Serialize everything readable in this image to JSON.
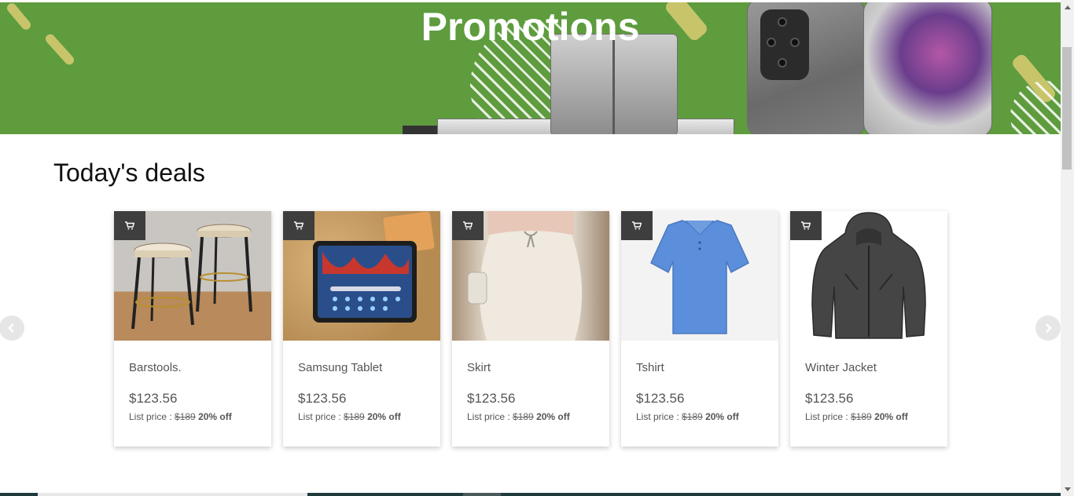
{
  "banner": {
    "title": "Promotions"
  },
  "section": {
    "title": "Today's deals"
  },
  "products": [
    {
      "name": "Barstools.",
      "price": "$123.56",
      "list_label": "List price : ",
      "list_price": "$189",
      "discount": "20% off",
      "image_icon": "barstools-image"
    },
    {
      "name": "Samsung Tablet",
      "price": "$123.56",
      "list_label": "List price : ",
      "list_price": "$189",
      "discount": "20% off",
      "image_icon": "tablet-image"
    },
    {
      "name": "Skirt",
      "price": "$123.56",
      "list_label": "List price : ",
      "list_price": "$189",
      "discount": "20% off",
      "image_icon": "skirt-image"
    },
    {
      "name": "Tshirt",
      "price": "$123.56",
      "list_label": "List price : ",
      "list_price": "$189",
      "discount": "20% off",
      "image_icon": "tshirt-image"
    },
    {
      "name": "Winter Jacket",
      "price": "$123.56",
      "list_label": "List price : ",
      "list_price": "$189",
      "discount": "20% off",
      "image_icon": "jacket-image"
    }
  ],
  "icons": {
    "cart": "cart-icon",
    "prev": "chevron-left-icon",
    "next": "chevron-right-icon"
  },
  "colors": {
    "banner": "#5e9c3e",
    "cart_button": "#3e3e3e",
    "footer": "#1f3a3a"
  }
}
